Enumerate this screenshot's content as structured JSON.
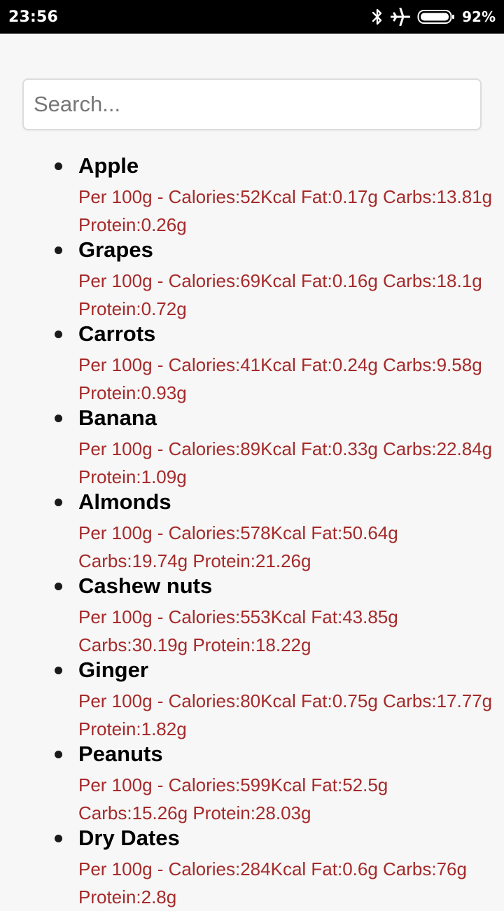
{
  "status_bar": {
    "time": "23:56",
    "battery_percent": "92%",
    "icons": [
      "bluetooth-icon",
      "airplane-mode-icon",
      "battery-icon"
    ]
  },
  "search": {
    "placeholder": "Search...",
    "value": ""
  },
  "colors": {
    "info_text": "#a52a2a",
    "name_text": "#000000",
    "background": "#f7f7f7"
  },
  "foods": [
    {
      "name": "Apple",
      "info": "Per 100g - Calories:52Kcal Fat:0.17g Carbs:13.81g Protein:0.26g"
    },
    {
      "name": "Grapes",
      "info": "Per 100g - Calories:69Kcal Fat:0.16g Carbs:18.1g Protein:0.72g"
    },
    {
      "name": "Carrots",
      "info": "Per 100g - Calories:41Kcal Fat:0.24g Carbs:9.58g Protein:0.93g"
    },
    {
      "name": "Banana",
      "info": "Per 100g - Calories:89Kcal Fat:0.33g Carbs:22.84g Protein:1.09g"
    },
    {
      "name": "Almonds",
      "info": "Per 100g - Calories:578Kcal Fat:50.64g Carbs:19.74g Protein:21.26g"
    },
    {
      "name": "Cashew nuts",
      "info": "Per 100g - Calories:553Kcal Fat:43.85g Carbs:30.19g Protein:18.22g"
    },
    {
      "name": "Ginger",
      "info": "Per 100g - Calories:80Kcal Fat:0.75g Carbs:17.77g Protein:1.82g"
    },
    {
      "name": "Peanuts",
      "info": "Per 100g - Calories:599Kcal Fat:52.5g Carbs:15.26g Protein:28.03g"
    },
    {
      "name": "Dry Dates",
      "info": "Per 100g - Calories:284Kcal Fat:0.6g Carbs:76g Protein:2.8g"
    }
  ]
}
